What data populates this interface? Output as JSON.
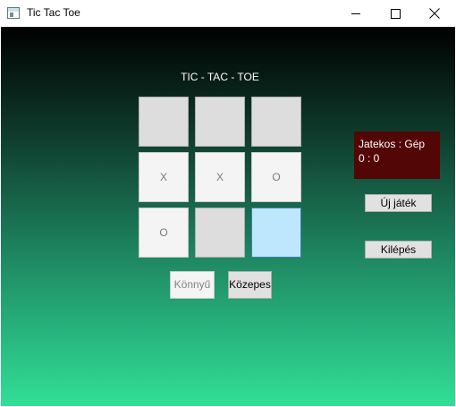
{
  "window": {
    "title": "Tic Tac Toe"
  },
  "game": {
    "heading": "TIC - TAC - TOE",
    "board": [
      "",
      "",
      "",
      "X",
      "X",
      "O",
      "O",
      "",
      ""
    ],
    "score_label": "Jatekos : Gép",
    "score_value": "0 : 0"
  },
  "buttons": {
    "new_game": "Új játék",
    "exit": "Kilépés",
    "easy": "Könnyű",
    "medium": "Közepes"
  },
  "colors": {
    "score_background": "#520605",
    "gradient_top": "#000000",
    "gradient_bottom": "#32df96",
    "hover_cell": "#bee6fd"
  }
}
